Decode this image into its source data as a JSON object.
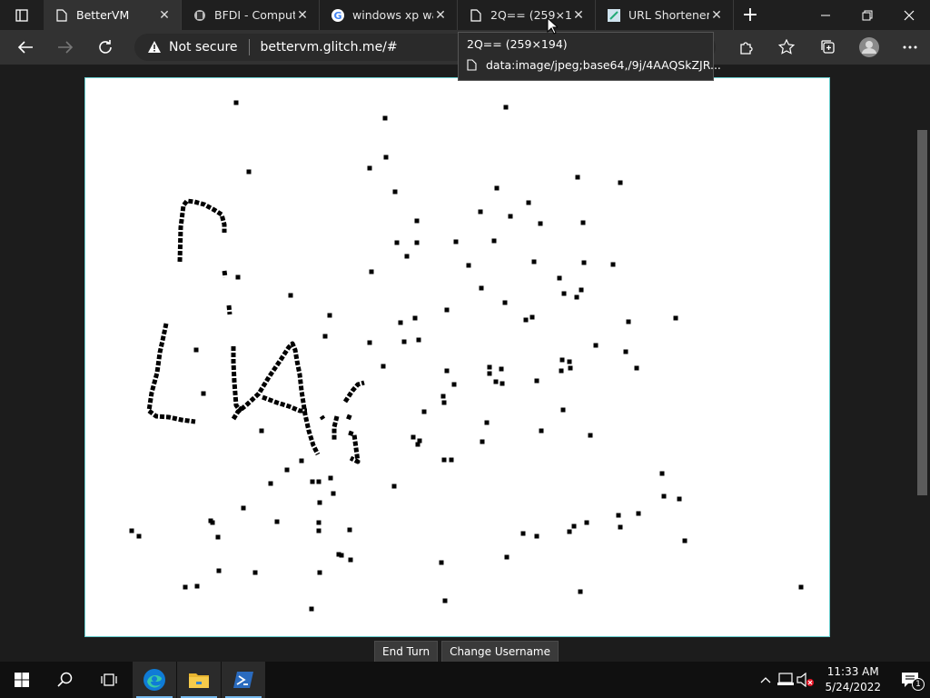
{
  "browser": {
    "tabs": [
      {
        "title": "BetterVM",
        "icon": "document-icon",
        "active": true
      },
      {
        "title": "BFDI - Compute",
        "icon": "bfdi-favicon-icon",
        "active": false
      },
      {
        "title": "windows xp wall",
        "icon": "google-icon",
        "active": false
      },
      {
        "title": "2Q== (259×194)",
        "icon": "document-icon",
        "active": false
      },
      {
        "title": "URL Shortener -",
        "icon": "url-shortener-favicon-icon",
        "active": false
      }
    ],
    "address": {
      "security": "Not secure",
      "url": "bettervm.glitch.me/#"
    },
    "tooltip": {
      "title": "2Q== (259×194)",
      "url": "data:image/jpeg;base64,/9j/4AAQSkZJR..."
    }
  },
  "page": {
    "buttons": {
      "end_turn": "End Turn",
      "change_username": "Change Username"
    }
  },
  "taskbar": {
    "apps": [
      "start-icon",
      "search-icon",
      "task-view-icon",
      "edge-icon",
      "file-explorer-icon",
      "powershell-icon"
    ],
    "time": "11:33 AM",
    "date": "5/24/2022",
    "notification_count": "1"
  },
  "colors": {
    "accent": "#76b9ed",
    "tab_active": "#323232",
    "toolbar": "#323232"
  }
}
